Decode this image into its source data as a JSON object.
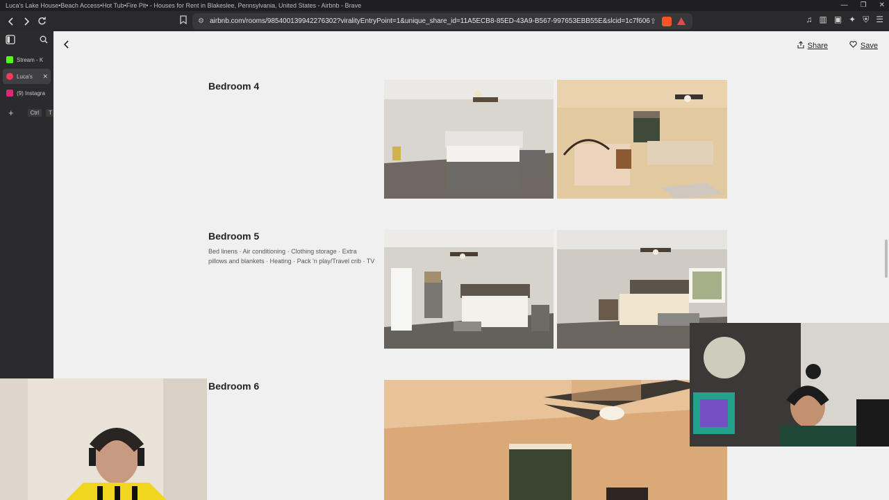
{
  "browser": {
    "window_title": "Luca's Lake House•Beach Access•Hot Tub•Fire Pit• - Houses for Rent in Blakeslee, Pennsylvania, United States - Airbnb - Brave",
    "url": "airbnb.com/rooms/985400139942276302?viralityEntryPoint=1&unique_share_id=11A5ECB8-85ED-43A9-B567-997653EBB55E&slcid=1c7f606552554...",
    "tabs": [
      {
        "label": "Stream - K",
        "color": "#53fc18"
      },
      {
        "label": "Luca's",
        "color": "#ff385c"
      },
      {
        "label": "(9) Instagra",
        "color": "#d62976"
      }
    ],
    "new_tab_shortcut": [
      "Ctrl",
      "T"
    ]
  },
  "header": {
    "share_label": "Share",
    "save_label": "Save"
  },
  "rooms": [
    {
      "title": "Bedroom 4",
      "amenities": ""
    },
    {
      "title": "Bedroom 5",
      "amenities": "Bed linens · Air conditioning · Clothing storage · Extra pillows and blankets · Heating · Pack 'n play/Travel crib · TV"
    },
    {
      "title": "Bedroom 6",
      "amenities": ""
    }
  ],
  "colors": {
    "accent": "#ff385c"
  }
}
